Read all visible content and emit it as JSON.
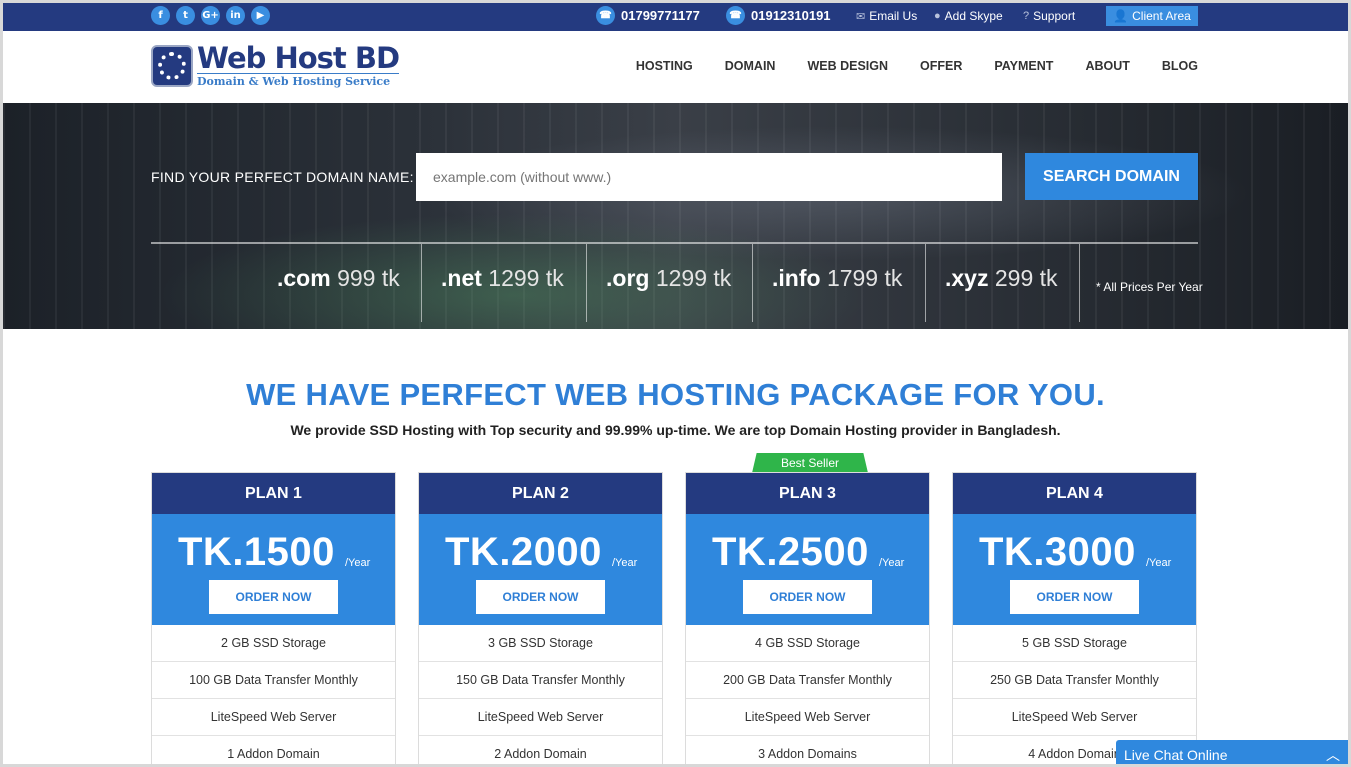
{
  "topbar": {
    "social": [
      "f",
      "t",
      "G+",
      "in",
      "▶"
    ],
    "phones": [
      "01799771177",
      "01912310191"
    ],
    "email_label": "Email Us",
    "skype_label": "Add Skype",
    "support_label": "Support",
    "client_label": "Client Area"
  },
  "header": {
    "logo_title": "Web Host BD",
    "logo_subtitle": "Domain & Web Hosting Service",
    "nav": [
      "HOSTING",
      "DOMAIN",
      "WEB DESIGN",
      "OFFER",
      "PAYMENT",
      "ABOUT",
      "BLOG"
    ]
  },
  "hero": {
    "find_label": "FIND YOUR PERFECT DOMAIN NAME:",
    "search_placeholder": "example.com (without www.)",
    "search_button": "SEARCH DOMAIN",
    "tlds": [
      {
        "ext": ".com",
        "price": "999 tk"
      },
      {
        "ext": ".net",
        "price": "1299 tk"
      },
      {
        "ext": ".org",
        "price": "1299 tk"
      },
      {
        "ext": ".info",
        "price": "1799 tk"
      },
      {
        "ext": ".xyz",
        "price": "299 tk"
      }
    ],
    "price_note": "* All Prices Per Year"
  },
  "main": {
    "headline": "WE HAVE PERFECT WEB HOSTING PACKAGE FOR YOU.",
    "subline": "We provide SSD Hosting with Top security and 99.99% up-time. We are top Domain Hosting provider in Bangladesh.",
    "best_seller": "Best Seller",
    "plans": [
      {
        "name": "PLAN 1",
        "price": "TK.1500",
        "per": "/Year",
        "order": "ORDER NOW",
        "features": [
          "2 GB SSD Storage",
          "100 GB Data Transfer Monthly",
          "LiteSpeed Web Server",
          "1 Addon Domain"
        ]
      },
      {
        "name": "PLAN 2",
        "price": "TK.2000",
        "per": "/Year",
        "order": "ORDER NOW",
        "features": [
          "3 GB SSD Storage",
          "150 GB Data Transfer Monthly",
          "LiteSpeed Web Server",
          "2 Addon Domain"
        ]
      },
      {
        "name": "PLAN 3",
        "price": "TK.2500",
        "per": "/Year",
        "order": "ORDER NOW",
        "features": [
          "4 GB SSD Storage",
          "200 GB Data Transfer Monthly",
          "LiteSpeed Web Server",
          "3 Addon Domains"
        ]
      },
      {
        "name": "PLAN 4",
        "price": "TK.3000",
        "per": "/Year",
        "order": "ORDER NOW",
        "features": [
          "5 GB SSD Storage",
          "250 GB Data Transfer Monthly",
          "LiteSpeed Web Server",
          "4 Addon Domain"
        ]
      }
    ]
  },
  "chat": {
    "label": "Live Chat Online",
    "toggle": "︿"
  }
}
